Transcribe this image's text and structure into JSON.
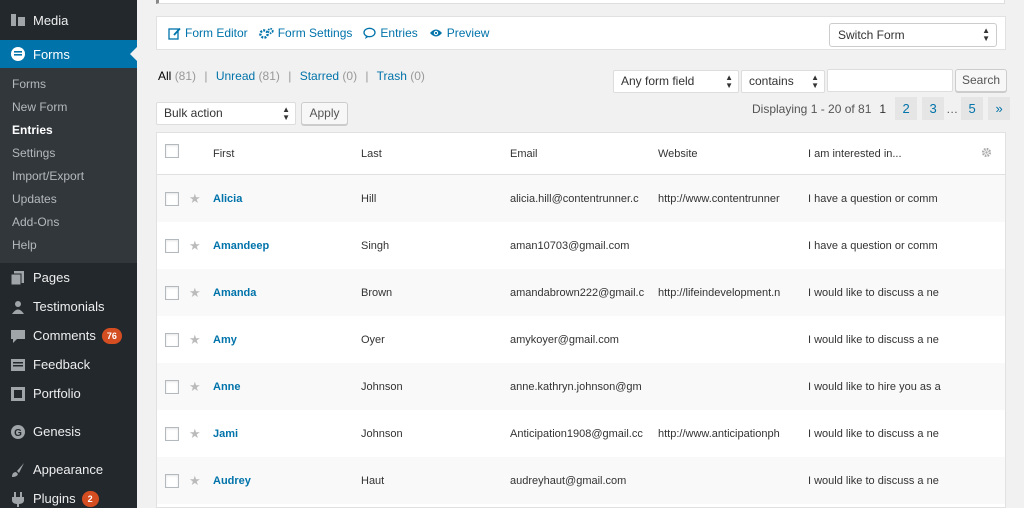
{
  "sidebar": {
    "media": "Media",
    "forms": "Forms",
    "submenu": [
      "Forms",
      "New Form",
      "Entries",
      "Settings",
      "Import/Export",
      "Updates",
      "Add-Ons",
      "Help"
    ],
    "pages": "Pages",
    "testimonials": "Testimonials",
    "comments": "Comments",
    "comments_badge": "76",
    "feedback": "Feedback",
    "portfolio": "Portfolio",
    "genesis": "Genesis",
    "appearance": "Appearance",
    "plugins": "Plugins",
    "plugins_badge": "2"
  },
  "toolbar": {
    "form_editor": "Form Editor",
    "form_settings": "Form Settings",
    "entries": "Entries",
    "preview": "Preview",
    "switch_form": "Switch Form"
  },
  "filters": {
    "all": "All",
    "all_count": "(81)",
    "unread": "Unread",
    "unread_count": "(81)",
    "starred": "Starred",
    "starred_count": "(0)",
    "trash": "Trash",
    "trash_count": "(0)",
    "sep": "|"
  },
  "search": {
    "field": "Any form field",
    "operator": "contains",
    "value": "",
    "button": "Search"
  },
  "bulk": {
    "action": "Bulk action",
    "apply": "Apply"
  },
  "pagination": {
    "displaying": "Displaying 1 - 20 of 81",
    "current": "1",
    "pages": [
      "2",
      "3",
      "5"
    ],
    "dots": "…",
    "next": "»"
  },
  "table": {
    "headers": {
      "first": "First",
      "last": "Last",
      "email": "Email",
      "website": "Website",
      "interest": "I am interested in..."
    },
    "rows": [
      {
        "first": "Alicia",
        "last": "Hill",
        "email": "alicia.hill@contentrunner.c",
        "website": "http://www.contentrunner",
        "interest": "I have a question or comm"
      },
      {
        "first": "Amandeep",
        "last": "Singh",
        "email": "aman10703@gmail.com",
        "website": "",
        "interest": "I have a question or comm"
      },
      {
        "first": "Amanda",
        "last": "Brown",
        "email": "amandabrown222@gmail.c",
        "website": "http://lifeindevelopment.n",
        "interest": "I would like to discuss a ne"
      },
      {
        "first": "Amy",
        "last": "Oyer",
        "email": "amykoyer@gmail.com",
        "website": "",
        "interest": "I would like to discuss a ne"
      },
      {
        "first": "Anne",
        "last": "Johnson",
        "email": "anne.kathryn.johnson@gm",
        "website": "",
        "interest": "I would like to hire you as a"
      },
      {
        "first": "Jami",
        "last": "Johnson",
        "email": "Anticipation1908@gmail.cc",
        "website": "http://www.anticipationph",
        "interest": "I would like to discuss a ne"
      },
      {
        "first": "Audrey",
        "last": "Haut",
        "email": "audreyhaut@gmail.com",
        "website": "",
        "interest": "I would like to discuss a ne"
      }
    ]
  }
}
